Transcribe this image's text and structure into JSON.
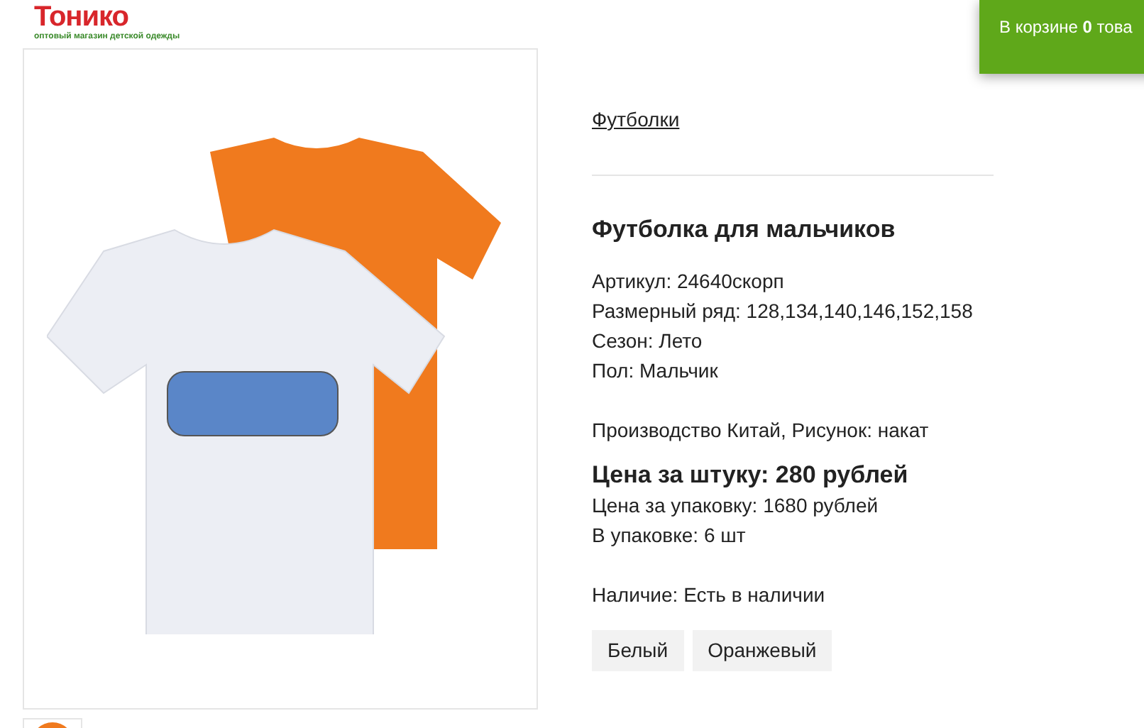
{
  "logo": {
    "title": "Тонико",
    "tagline": "оптовый магазин детской одежды"
  },
  "cart": {
    "label": "В корзине **0** това"
  },
  "breadcrumb": "Футболки",
  "product": {
    "title": "Футболка для мальчиков",
    "attributes": [
      "Артикул: 24640скорп",
      "Размерный ряд: 128,134,140,146,152,158",
      "Сезон: Лето",
      "Пол: Мальчик"
    ],
    "production": "Производство Китай, Рисунок: накат",
    "price": "Цена за штуку: 280 рублей",
    "pack_info": [
      "Цена за упаковку: 1680 рублей",
      "В упаковке: 6 шт"
    ],
    "availability": "Наличие: Есть в наличии",
    "colors": [
      {
        "label": "Белый",
        "selected": false
      },
      {
        "label": "Оранжевый",
        "selected": false
      }
    ]
  }
}
